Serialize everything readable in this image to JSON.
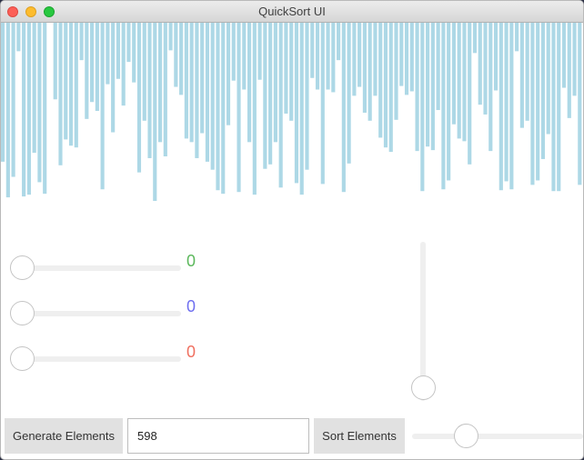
{
  "window": {
    "title": "QuickSort UI"
  },
  "visualization": {
    "bar_color": "#add8e6",
    "max_value": 200,
    "values": [
      156,
      196,
      173,
      32,
      195,
      193,
      146,
      179,
      192,
      0,
      86,
      160,
      131,
      138,
      140,
      42,
      108,
      89,
      99,
      187,
      69,
      123,
      63,
      93,
      44,
      67,
      168,
      110,
      152,
      200,
      134,
      150,
      31,
      72,
      81,
      130,
      134,
      152,
      124,
      156,
      165,
      188,
      192,
      115,
      65,
      190,
      75,
      134,
      193,
      64,
      164,
      159,
      134,
      185,
      102,
      110,
      180,
      193,
      165,
      62,
      75,
      181,
      75,
      78,
      42,
      190,
      158,
      82,
      72,
      101,
      110,
      82,
      129,
      140,
      145,
      109,
      71,
      81,
      77,
      144,
      189,
      139,
      143,
      98,
      187,
      177,
      114,
      130,
      133,
      159,
      34,
      92,
      103,
      144,
      76,
      188,
      178,
      187,
      32,
      118,
      110,
      182,
      177,
      153,
      125,
      189,
      189,
      73,
      107,
      82,
      182
    ]
  },
  "sliders": {
    "green_value": "0",
    "blue_value": "0",
    "red_value": "0",
    "green_color": "#5cb85c",
    "blue_color": "#6f6ff0",
    "red_color": "#f07060"
  },
  "controls": {
    "generate_label": "Generate Elements",
    "elements_value": "598",
    "sort_label": "Sort Elements"
  }
}
